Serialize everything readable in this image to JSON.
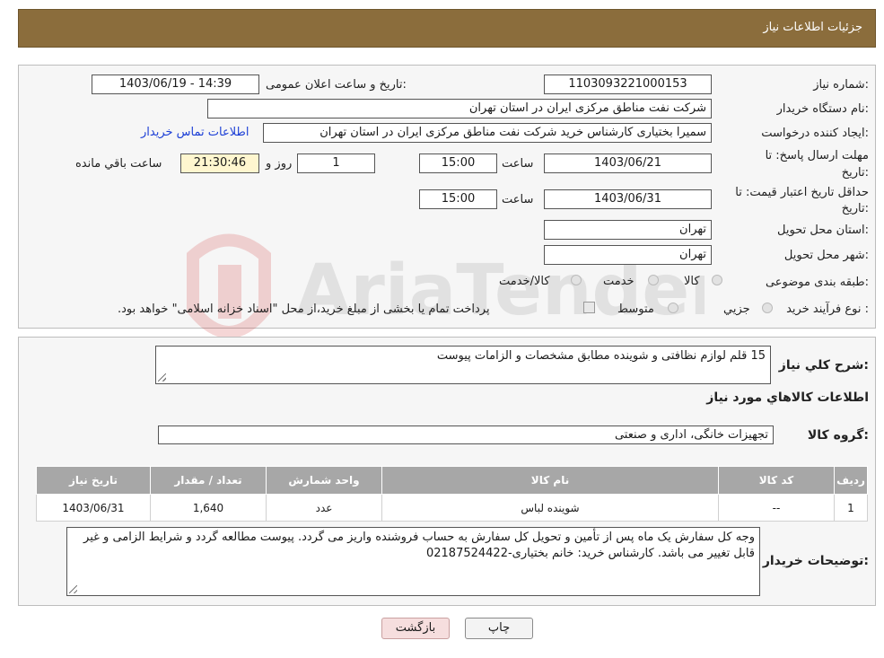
{
  "header": {
    "title": "جزئیات اطلاعات نیاز"
  },
  "form": {
    "need_no_label": "شماره نیاز:",
    "need_no": "1103093221000153",
    "announce_label": "تاریخ و ساعت اعلان عمومی:",
    "announce_value": "1403/06/19 - 14:39",
    "buyer_org_label": "نام دستگاه خریدار:",
    "buyer_org": "شرکت نفت مناطق مرکزی ایران در استان تهران",
    "creator_label": "ایجاد کننده درخواست:",
    "creator": "سمیرا بختیاری کارشناس خرید شرکت نفت مناطق مرکزی ایران در استان تهران",
    "contact_link": "اطلاعات تماس خریدار",
    "deadline_label": "مهلت ارسال پاسخ: تا",
    "deadline_label2": "تاریخ:",
    "deadline_date": "1403/06/21",
    "time_label": "ساعت",
    "deadline_time": "15:00",
    "days": "1",
    "days_label": "روز و",
    "remaining": "21:30:46",
    "remaining_label": "ساعت باقي مانده",
    "validity_label": "حداقل تاریخ اعتبار قیمت: تا",
    "validity_label2": "تاریخ:",
    "validity_date": "1403/06/31",
    "validity_time": "15:00",
    "province_label": "استان محل تحویل:",
    "province": "تهران",
    "city_label": "شهر محل تحویل:",
    "city": "تهران",
    "category_label": "طبقه بندی موضوعی:",
    "cat_opt1": "کالا",
    "cat_opt2": "خدمت",
    "cat_opt3": "کالا/خدمت",
    "process_label": "نوع فرآیند خرید :",
    "proc_opt1": "جزيي",
    "proc_opt2": "متوسط",
    "proc_note": "پرداخت تمام یا بخشی از مبلغ خرید،از محل \"اسناد خزانه اسلامی\" خواهد بود."
  },
  "details": {
    "desc_label": "شرح کلي نياز:",
    "desc": "15 قلم لوازم نظافتی و شوینده مطابق مشخصات و الزامات پیوست",
    "items_title": "اطلاعات کالاهاي مورد نياز",
    "group_label": "گروه کالا:",
    "group": "تجهیزات خانگی، اداری و صنعتی",
    "table": {
      "headers": [
        "رديف",
        "کد کالا",
        "نام کالا",
        "واحد شمارش",
        "تعداد / مقدار",
        "تاریخ نیاز"
      ],
      "rows": [
        [
          "1",
          "--",
          "شوینده لباس",
          "عدد",
          "1,640",
          "1403/06/31"
        ]
      ]
    },
    "notes_label": "توضیحات خریدار:",
    "notes": "وجه کل سفارش یک ماه پس از تأمین و تحویل کل سفارش به حساب فروشنده واریز می گردد. پیوست مطالعه گردد و شرایط الزامی و غیر قابل تغییر می باشد. کارشناس خرید: خانم بختیاری-02187524422"
  },
  "buttons": {
    "print": "چاپ",
    "back": "بازگشت"
  },
  "watermark": {
    "text": "AriaTender.neT"
  }
}
